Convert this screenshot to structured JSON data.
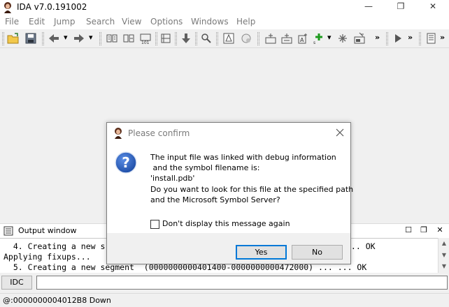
{
  "window": {
    "title": "IDA v7.0.191002",
    "minimize_glyph": "—",
    "maximize_glyph": "❐",
    "close_glyph": "✕"
  },
  "menu": [
    "File",
    "Edit",
    "Jump",
    "Search",
    "View",
    "Options",
    "Windows",
    "Help"
  ],
  "toolbar": {
    "icons": [
      "open-icon",
      "save-icon",
      "back-icon",
      "forward-icon",
      "jump-icon",
      "code-icon",
      "data-icon",
      "binary-icon",
      "struct-icon",
      "down-arrow-icon",
      "search-icon",
      "graph-icon",
      "proximity-icon",
      "debug-icon",
      "patch-icon",
      "add-icon",
      "cross-ref-icon",
      "segment-icon",
      "run-icon",
      "options-icon"
    ],
    "overflow_glyph": "»"
  },
  "output": {
    "title": "Output window",
    "lines": [
      "  4. Creating a new s",
      "Applying fixups...",
      "  5. Creating a new segment  (0000000000401400-0000000000472000) ... ... OK"
    ],
    "line1_tail": "... OK"
  },
  "command": {
    "idc_label": "IDC",
    "value": ""
  },
  "status": {
    "text": "@:0000000004012B8 Down"
  },
  "dialog": {
    "title": "Please confirm",
    "message_lines": [
      "The input file was linked with debug information",
      " and the symbol filename is:",
      "'install.pdb'",
      "Do you want to look for this file at the specified path",
      "and the Microsoft Symbol Server?"
    ],
    "checkbox_label": "Don't display this message again",
    "checkbox_checked": false,
    "yes_label": "Yes",
    "no_label": "No"
  },
  "colors": {
    "accent": "#0078d7",
    "question_icon": "#1f4fa8"
  }
}
